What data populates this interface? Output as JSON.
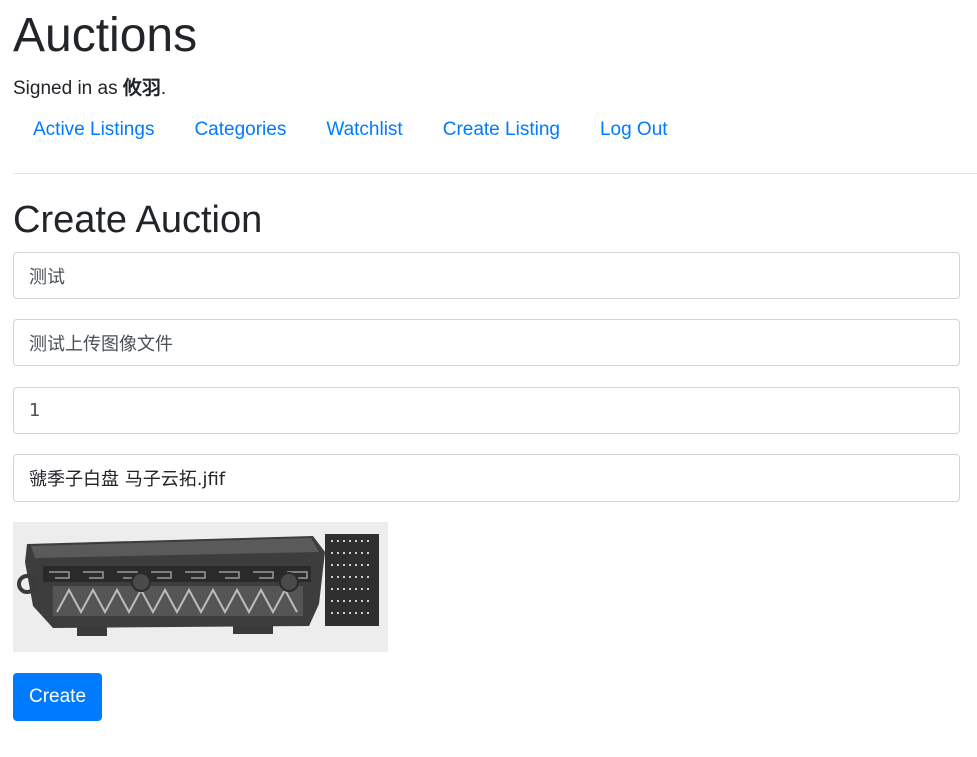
{
  "header": {
    "site_title": "Auctions",
    "signed_in_prefix": "Signed in as ",
    "username": "攸羽",
    "signed_in_suffix": "."
  },
  "nav": [
    {
      "label": "Active Listings"
    },
    {
      "label": "Categories"
    },
    {
      "label": "Watchlist"
    },
    {
      "label": "Create Listing"
    },
    {
      "label": "Log Out"
    }
  ],
  "form": {
    "title": "Create Auction",
    "fields": [
      {
        "value": "测试"
      },
      {
        "value": "测试上传图像文件"
      },
      {
        "value": "1"
      }
    ],
    "file_name": "虢季子白盘 马子云拓.jfif",
    "submit_label": "Create"
  },
  "colors": {
    "link": "#007bff",
    "button": "#007bff",
    "text": "#212529",
    "border": "#ced4da"
  }
}
